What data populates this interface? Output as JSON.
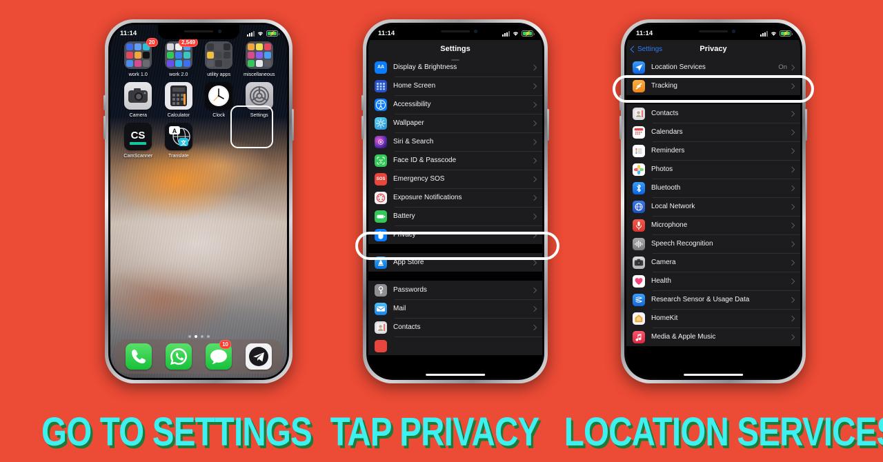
{
  "background_color": "#ec4b35",
  "caption_color": "#3ef0f0",
  "caption_shadow_color": "#1e7a38",
  "captions": [
    {
      "text": "GO TO SETTINGS"
    },
    {
      "text": "TAP PRIVACY"
    },
    {
      "text": "LOCATION SERVICES"
    }
  ],
  "phone1": {
    "status": {
      "time": "11:14",
      "signal": "signal-bars",
      "wifi": "wifi-icon",
      "battery": "battery-charging"
    },
    "apps": [
      {
        "label": "work 1.0",
        "badge": "20",
        "type": "folder"
      },
      {
        "label": "work 2.0",
        "badge": "2,549",
        "type": "folder"
      },
      {
        "label": "utility apps",
        "badge": "",
        "type": "folder"
      },
      {
        "label": "miscellaneous",
        "badge": "",
        "type": "folder"
      },
      {
        "label": "Camera",
        "badge": "",
        "type": "app"
      },
      {
        "label": "Calculator",
        "badge": "",
        "type": "app"
      },
      {
        "label": "Clock",
        "badge": "",
        "type": "app"
      },
      {
        "label": "Settings",
        "badge": "",
        "type": "app"
      },
      {
        "label": "CamScanner",
        "badge": "",
        "type": "app"
      },
      {
        "label": "Translate",
        "badge": "",
        "type": "app"
      }
    ],
    "page_dots": {
      "count": 4,
      "active_index": 1
    },
    "dock": [
      {
        "label": "Phone",
        "badge": ""
      },
      {
        "label": "WhatsApp",
        "badge": ""
      },
      {
        "label": "Messages",
        "badge": "10"
      },
      {
        "label": "Telegram",
        "badge": ""
      }
    ],
    "highlight": "Settings"
  },
  "phone2": {
    "status": {
      "time": "11:14"
    },
    "nav_title": "Settings",
    "groups": [
      {
        "rows": [
          {
            "label": "Display & Brightness",
            "value": "",
            "icon": "display-brightness-icon",
            "color": "#0a7cff",
            "glyph": "AA"
          },
          {
            "label": "Home Screen",
            "value": "",
            "icon": "home-screen-icon",
            "color": "#2b4fc8",
            "glyph": ""
          },
          {
            "label": "Accessibility",
            "value": "",
            "icon": "accessibility-icon",
            "color": "#0a7cff",
            "glyph": ""
          },
          {
            "label": "Wallpaper",
            "value": "",
            "icon": "wallpaper-icon",
            "color": "#41b7e8",
            "glyph": ""
          },
          {
            "label": "Siri & Search",
            "value": "",
            "icon": "siri-icon",
            "color": "#2a1a4d",
            "glyph": ""
          },
          {
            "label": "Face ID & Passcode",
            "value": "",
            "icon": "face-id-icon",
            "color": "#34c759",
            "glyph": ""
          },
          {
            "label": "Emergency SOS",
            "value": "",
            "icon": "emergency-sos-icon",
            "color": "#e8453c",
            "glyph": "SOS"
          },
          {
            "label": "Exposure Notifications",
            "value": "",
            "icon": "exposure-notifications-icon",
            "color": "#f5f5f5",
            "glyph": ""
          },
          {
            "label": "Battery",
            "value": "",
            "icon": "battery-icon",
            "color": "#34c759",
            "glyph": ""
          },
          {
            "label": "Privacy",
            "value": "",
            "icon": "privacy-hand-icon",
            "color": "#0a7cff",
            "glyph": ""
          }
        ]
      },
      {
        "rows": [
          {
            "label": "App Store",
            "value": "",
            "icon": "app-store-icon",
            "color": "#1e8fe8",
            "glyph": "A"
          }
        ]
      },
      {
        "rows": [
          {
            "label": "Passwords",
            "value": "",
            "icon": "passwords-key-icon",
            "color": "#8e8e93",
            "glyph": ""
          },
          {
            "label": "Mail",
            "value": "",
            "icon": "mail-icon",
            "color": "#2a9ef5",
            "glyph": ""
          },
          {
            "label": "Contacts",
            "value": "",
            "icon": "contacts-icon",
            "color": "#d8d8dc",
            "glyph": ""
          }
        ]
      }
    ],
    "highlight": "Privacy"
  },
  "phone3": {
    "status": {
      "time": "11:14"
    },
    "back_label": "Settings",
    "nav_title": "Privacy",
    "groups": [
      {
        "rows": [
          {
            "label": "Location Services",
            "value": "On",
            "icon": "location-arrow-icon",
            "color": "#0a7cff",
            "glyph": ""
          },
          {
            "label": "Tracking",
            "value": "",
            "icon": "tracking-icon",
            "color": "#f09a1e",
            "glyph": ""
          }
        ]
      },
      {
        "rows": [
          {
            "label": "Contacts",
            "value": "",
            "icon": "contacts-icon",
            "color": "#d8d8dc",
            "glyph": ""
          },
          {
            "label": "Calendars",
            "value": "",
            "icon": "calendar-icon",
            "color": "#ffffff",
            "glyph": ""
          },
          {
            "label": "Reminders",
            "value": "",
            "icon": "reminders-icon",
            "color": "#ffffff",
            "glyph": ""
          },
          {
            "label": "Photos",
            "value": "",
            "icon": "photos-icon",
            "color": "#ffffff",
            "glyph": ""
          },
          {
            "label": "Bluetooth",
            "value": "",
            "icon": "bluetooth-icon",
            "color": "#0a7cff",
            "glyph": ""
          },
          {
            "label": "Local Network",
            "value": "",
            "icon": "local-network-icon",
            "color": "#1f6fd0",
            "glyph": ""
          },
          {
            "label": "Microphone",
            "value": "",
            "icon": "microphone-icon",
            "color": "#e8453c",
            "glyph": ""
          },
          {
            "label": "Speech Recognition",
            "value": "",
            "icon": "speech-recognition-icon",
            "color": "#8e8e93",
            "glyph": ""
          },
          {
            "label": "Camera",
            "value": "",
            "icon": "camera-icon",
            "color": "#4a4a4e",
            "glyph": ""
          },
          {
            "label": "Health",
            "value": "",
            "icon": "health-icon",
            "color": "#ffffff",
            "glyph": ""
          },
          {
            "label": "Research Sensor & Usage Data",
            "value": "",
            "icon": "research-sensor-icon",
            "color": "#1e7ae8",
            "glyph": ""
          },
          {
            "label": "HomeKit",
            "value": "",
            "icon": "homekit-icon",
            "color": "#f2f2f2",
            "glyph": ""
          },
          {
            "label": "Media & Apple Music",
            "value": "",
            "icon": "media-apple-music-icon",
            "color": "#e8374f",
            "glyph": ""
          }
        ]
      }
    ],
    "highlight": "Location Services"
  }
}
